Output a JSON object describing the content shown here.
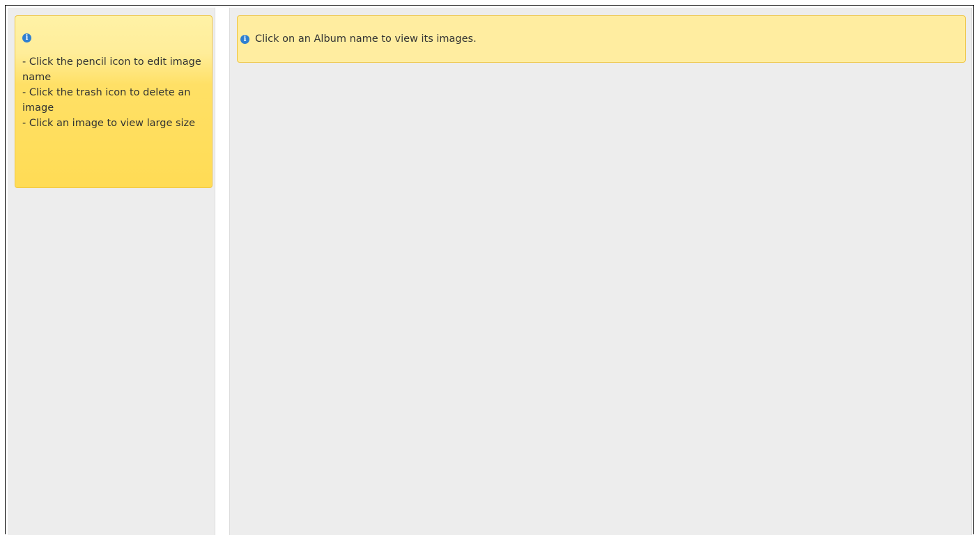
{
  "left_panel": {
    "info_icon": "info-circle-icon",
    "help_lines": [
      "- Click the pencil icon to edit image name",
      "- Click the trash icon to delete an image",
      "- Click an image to view large size"
    ]
  },
  "main_panel": {
    "info_icon": "info-circle-icon",
    "notice_text": "Click on an Album name to view its images."
  },
  "colors": {
    "panel_background": "#ededed",
    "notice_background": "#ffeda0",
    "help_box_gradient_top": "#fff2a6",
    "help_box_gradient_bottom": "#ffdc55",
    "info_icon": "#2f7fd1",
    "border_yellow": "#f0c744"
  }
}
